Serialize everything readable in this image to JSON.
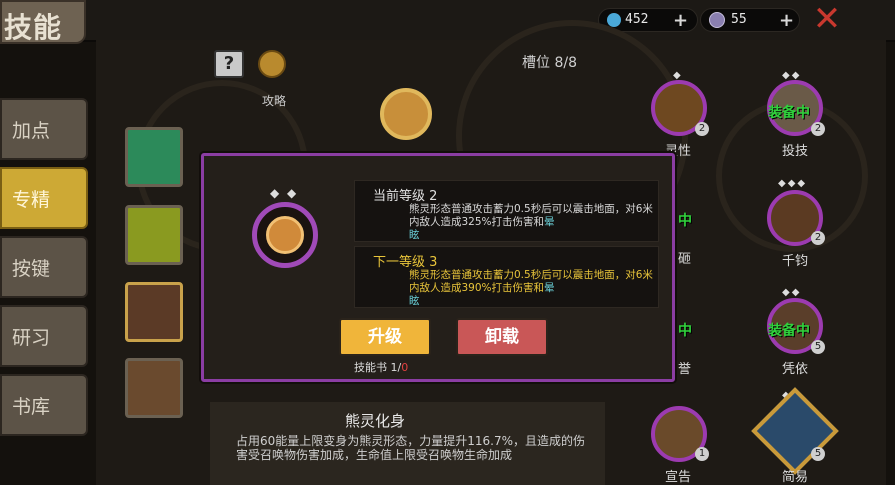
{
  "header": {
    "title": "技能",
    "gems": {
      "icon": "blue-gem-icon",
      "value": "452"
    },
    "materials": {
      "icon": "purple-crystal-icon",
      "value": "55"
    }
  },
  "sidebar": {
    "items": [
      {
        "label": "加点",
        "active": false
      },
      {
        "label": "专精",
        "active": true
      },
      {
        "label": "按键",
        "active": false
      },
      {
        "label": "研习",
        "active": false
      },
      {
        "label": "书库",
        "active": false
      }
    ]
  },
  "toolbar": {
    "help_icon": "question-mark-icon",
    "guide_label": "攻略",
    "slots_label": "槽位 8/8"
  },
  "right_skills": [
    {
      "label": "灵性",
      "level": "2",
      "equipped": ""
    },
    {
      "label": "投技",
      "level": "2",
      "equipped": "装备中"
    },
    {
      "label": "千钧",
      "level": "2",
      "equipped": ""
    },
    {
      "label": "凭依",
      "level": "5",
      "equipped": "装备中"
    },
    {
      "label": "宣告",
      "level": "1",
      "equipped": ""
    },
    {
      "label": "简易",
      "level": "5",
      "equipped": ""
    }
  ],
  "partial_labels": {
    "a": "砸",
    "b": "誉",
    "c": "中",
    "d": "中"
  },
  "dialog": {
    "current_label": "当前等级 2",
    "current_desc_a": "熊灵形态普通攻击蓄力0.5秒后可以震击地面，对6米内敌人造成325%打击伤害和",
    "current_desc_b": "晕",
    "current_desc_c": "眩",
    "next_label": "下一等级 3",
    "next_desc_a": "熊灵形态普通攻击蓄力0.5秒后可以震击地面，对6米内敌人造成390%打击伤害和",
    "next_desc_b": "晕",
    "next_desc_c": "眩",
    "upgrade_label": "升级",
    "unload_label": "卸载",
    "book_label": "技能书 1/",
    "book_count": "0"
  },
  "skill": {
    "name": "熊灵化身",
    "description": "占用60能量上限变身为熊灵形态，力量提升116.7%，且造成的伤害受召唤物伤害加成，生命值上限受召唤物生命加成"
  },
  "colors": {
    "accent": "#cda935",
    "dialog_border": "#8b3da3",
    "upgrade": "#f0b53a",
    "unload": "#c95757",
    "equipped": "#30d23c",
    "highlight": "#e8c43a"
  }
}
